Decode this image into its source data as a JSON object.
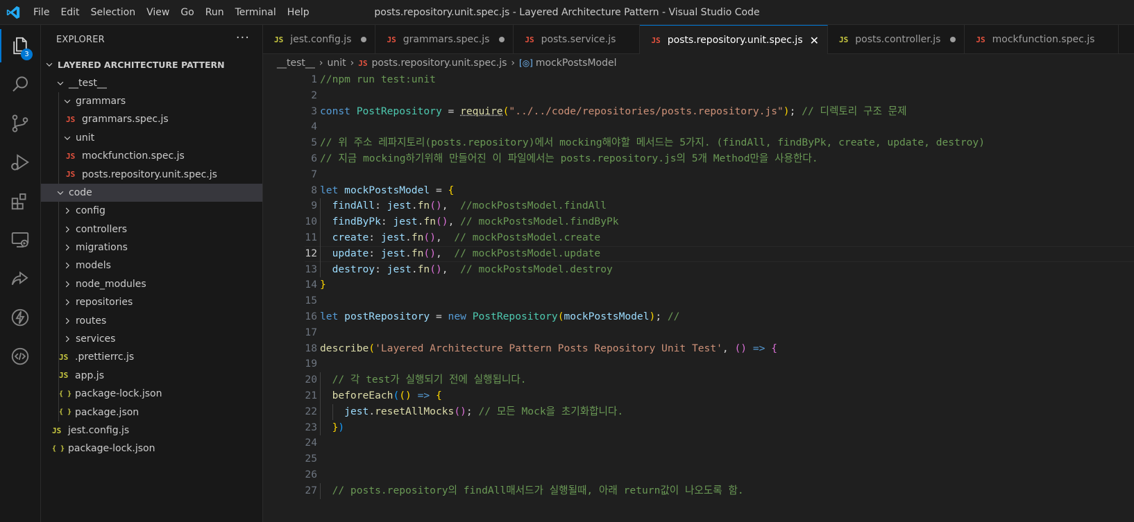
{
  "titlebar": {
    "menu": [
      "File",
      "Edit",
      "Selection",
      "View",
      "Go",
      "Run",
      "Terminal",
      "Help"
    ],
    "title": "posts.repository.unit.spec.js - Layered Architecture Pattern - Visual Studio Code"
  },
  "activitybar": {
    "icons": [
      "explorer-icon",
      "search-icon",
      "source-control-icon",
      "run-debug-icon",
      "extensions-icon",
      "remote-explorer-icon",
      "live-share-icon",
      "thunder-client-icon",
      "api-icon"
    ],
    "badge": "3"
  },
  "sidebar": {
    "title": "EXPLORER",
    "more": "···",
    "tree": [
      {
        "label": "LAYERED ARCHITECTURE PATTERN",
        "depth": 0,
        "kind": "root"
      },
      {
        "label": "__test__",
        "depth": 1,
        "kind": "folder-open"
      },
      {
        "label": "grammars",
        "depth": 2,
        "kind": "folder-open"
      },
      {
        "label": "grammars.spec.js",
        "depth": 3,
        "kind": "js"
      },
      {
        "label": "unit",
        "depth": 2,
        "kind": "folder-open"
      },
      {
        "label": "mockfunction.spec.js",
        "depth": 3,
        "kind": "js"
      },
      {
        "label": "posts.repository.unit.spec.js",
        "depth": 3,
        "kind": "js"
      },
      {
        "label": "code",
        "depth": 1,
        "kind": "folder-open",
        "selected": true
      },
      {
        "label": "config",
        "depth": 2,
        "kind": "folder"
      },
      {
        "label": "controllers",
        "depth": 2,
        "kind": "folder"
      },
      {
        "label": "migrations",
        "depth": 2,
        "kind": "folder"
      },
      {
        "label": "models",
        "depth": 2,
        "kind": "folder"
      },
      {
        "label": "node_modules",
        "depth": 2,
        "kind": "folder"
      },
      {
        "label": "repositories",
        "depth": 2,
        "kind": "folder"
      },
      {
        "label": "routes",
        "depth": 2,
        "kind": "folder"
      },
      {
        "label": "services",
        "depth": 2,
        "kind": "folder"
      },
      {
        "label": ".prettierrc.js",
        "depth": 2,
        "kind": "jsy"
      },
      {
        "label": "app.js",
        "depth": 2,
        "kind": "jsy"
      },
      {
        "label": "package-lock.json",
        "depth": 2,
        "kind": "json"
      },
      {
        "label": "package.json",
        "depth": 2,
        "kind": "json"
      },
      {
        "label": "jest.config.js",
        "depth": 1,
        "kind": "jsy"
      },
      {
        "label": "package-lock.json",
        "depth": 1,
        "kind": "json"
      }
    ]
  },
  "tabs": [
    {
      "label": "jest.config.js",
      "icon": "jsy",
      "state": "dot"
    },
    {
      "label": "grammars.spec.js",
      "icon": "js",
      "state": "dot"
    },
    {
      "label": "posts.service.js",
      "icon": "js",
      "state": "none"
    },
    {
      "label": "posts.repository.unit.spec.js",
      "icon": "js",
      "state": "close",
      "active": true
    },
    {
      "label": "posts.controller.js",
      "icon": "jsy",
      "state": "dot"
    },
    {
      "label": "mockfunction.spec.js",
      "icon": "js",
      "state": "none"
    }
  ],
  "breadcrumb": [
    "__test__",
    "unit",
    "posts.repository.unit.spec.js",
    "mockPostsModel"
  ],
  "editor": {
    "current_line": 12,
    "lines": [
      {
        "n": "1",
        "tokens": [
          [
            "c",
            "//npm run test:unit"
          ]
        ]
      },
      {
        "n": "2",
        "tokens": []
      },
      {
        "n": "3",
        "tokens": [
          [
            "k",
            "const "
          ],
          [
            "cl",
            "PostRepository"
          ],
          [
            "p",
            " = "
          ],
          [
            "f ul",
            "require"
          ],
          [
            "b1",
            "("
          ],
          [
            "s",
            "\"../../code/repositories/posts.repository.js\""
          ],
          [
            "b1",
            ")"
          ],
          [
            "p",
            "; "
          ],
          [
            "c",
            "// 디렉토리 구조 문제"
          ]
        ]
      },
      {
        "n": "4",
        "tokens": []
      },
      {
        "n": "5",
        "tokens": [
          [
            "c",
            "// 위 주소 레파지토리(posts.repository)에서 mocking해야할 메서드는 5가지. (findAll, findByPk, create, update, destroy)"
          ]
        ]
      },
      {
        "n": "6",
        "tokens": [
          [
            "c",
            "// 지금 mocking하기위해 만들어진 이 파일에서는 posts.repository.js의 5개 Method만을 사용한다."
          ]
        ]
      },
      {
        "n": "7",
        "tokens": []
      },
      {
        "n": "8",
        "tokens": [
          [
            "k",
            "let "
          ],
          [
            "v",
            "mockPostsModel"
          ],
          [
            "p",
            " = "
          ],
          [
            "b1",
            "{"
          ]
        ]
      },
      {
        "n": "9",
        "tokens": [
          [
            "p",
            "  "
          ],
          [
            "v",
            "findAll"
          ],
          [
            "p",
            ": "
          ],
          [
            "v",
            "jest"
          ],
          [
            "p",
            "."
          ],
          [
            "f",
            "fn"
          ],
          [
            "b2",
            "()"
          ],
          [
            "p",
            ",  "
          ],
          [
            "c",
            "//mockPostsModel.findAll"
          ]
        ]
      },
      {
        "n": "10",
        "tokens": [
          [
            "p",
            "  "
          ],
          [
            "v",
            "findByPk"
          ],
          [
            "p",
            ": "
          ],
          [
            "v",
            "jest"
          ],
          [
            "p",
            "."
          ],
          [
            "f",
            "fn"
          ],
          [
            "b2",
            "()"
          ],
          [
            "p",
            ", "
          ],
          [
            "c",
            "// mockPostsModel.findByPk"
          ]
        ]
      },
      {
        "n": "11",
        "tokens": [
          [
            "p",
            "  "
          ],
          [
            "v",
            "create"
          ],
          [
            "p",
            ": "
          ],
          [
            "v",
            "jest"
          ],
          [
            "p",
            "."
          ],
          [
            "f",
            "fn"
          ],
          [
            "b2",
            "()"
          ],
          [
            "p",
            ",  "
          ],
          [
            "c",
            "// mockPostsModel.create"
          ]
        ]
      },
      {
        "n": "12",
        "tokens": [
          [
            "p",
            "  "
          ],
          [
            "v",
            "update"
          ],
          [
            "p",
            ": "
          ],
          [
            "v",
            "jest"
          ],
          [
            "p",
            "."
          ],
          [
            "f",
            "fn"
          ],
          [
            "b2",
            "()"
          ],
          [
            "p",
            ",  "
          ],
          [
            "c",
            "// mockPostsModel.update"
          ]
        ]
      },
      {
        "n": "13",
        "tokens": [
          [
            "p",
            "  "
          ],
          [
            "v",
            "destroy"
          ],
          [
            "p",
            ": "
          ],
          [
            "v",
            "jest"
          ],
          [
            "p",
            "."
          ],
          [
            "f",
            "fn"
          ],
          [
            "b2",
            "()"
          ],
          [
            "p",
            ",  "
          ],
          [
            "c",
            "// mockPostsModel.destroy"
          ]
        ]
      },
      {
        "n": "14",
        "tokens": [
          [
            "b1",
            "}"
          ]
        ]
      },
      {
        "n": "15",
        "tokens": []
      },
      {
        "n": "16",
        "tokens": [
          [
            "k",
            "let "
          ],
          [
            "v",
            "postRepository"
          ],
          [
            "p",
            " = "
          ],
          [
            "k",
            "new "
          ],
          [
            "cl",
            "PostRepository"
          ],
          [
            "b1",
            "("
          ],
          [
            "v",
            "mockPostsModel"
          ],
          [
            "b1",
            ")"
          ],
          [
            "p",
            "; "
          ],
          [
            "c",
            "//"
          ]
        ]
      },
      {
        "n": "17",
        "tokens": []
      },
      {
        "n": "18",
        "tokens": [
          [
            "f",
            "describe"
          ],
          [
            "b1",
            "("
          ],
          [
            "s",
            "'Layered Architecture Pattern Posts Repository Unit Test'"
          ],
          [
            "p",
            ", "
          ],
          [
            "b2",
            "()"
          ],
          [
            "p",
            " "
          ],
          [
            "k",
            "=>"
          ],
          [
            "p",
            " "
          ],
          [
            "b2",
            "{"
          ]
        ]
      },
      {
        "n": "19",
        "tokens": []
      },
      {
        "n": "20",
        "tokens": [
          [
            "p",
            "  "
          ],
          [
            "c",
            "// 각 test가 실행되기 전에 실행됩니다."
          ]
        ]
      },
      {
        "n": "21",
        "tokens": [
          [
            "p",
            "  "
          ],
          [
            "f",
            "beforeEach"
          ],
          [
            "b3",
            "("
          ],
          [
            "b1",
            "()"
          ],
          [
            "p",
            " "
          ],
          [
            "k",
            "=>"
          ],
          [
            "p",
            " "
          ],
          [
            "b1",
            "{"
          ]
        ]
      },
      {
        "n": "22",
        "tokens": [
          [
            "p",
            "    "
          ],
          [
            "v",
            "jest"
          ],
          [
            "p",
            "."
          ],
          [
            "f",
            "resetAllMocks"
          ],
          [
            "b2",
            "()"
          ],
          [
            "p",
            "; "
          ],
          [
            "c",
            "// 모든 Mock을 초기화합니다."
          ]
        ]
      },
      {
        "n": "23",
        "tokens": [
          [
            "p",
            "  "
          ],
          [
            "b1",
            "}"
          ],
          [
            "b3",
            ")"
          ]
        ]
      },
      {
        "n": "24",
        "tokens": []
      },
      {
        "n": "25",
        "tokens": []
      },
      {
        "n": "26",
        "tokens": []
      },
      {
        "n": "27",
        "tokens": [
          [
            "p",
            "  "
          ],
          [
            "c",
            "// posts.repository의 findAll매서드가 실행될때, 아래 return값이 나오도록 함."
          ]
        ]
      }
    ]
  }
}
